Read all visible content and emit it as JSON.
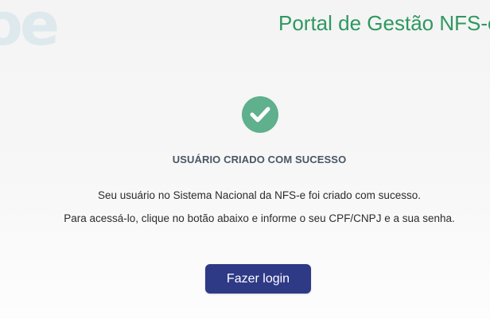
{
  "header": {
    "watermark": "oe",
    "title": "Portal de Gestão NFS-e"
  },
  "status": {
    "icon": "check-circle-icon",
    "heading": "USUÁRIO CRIADO COM SUCESSO"
  },
  "messages": {
    "line1": "Seu usuário no Sistema Nacional da NFS-e foi criado com sucesso.",
    "line2": "Para acessá-lo, clique no botão abaixo e informe o seu CPF/CNPJ e a sua senha."
  },
  "actions": {
    "login_label": "Fazer login"
  },
  "colors": {
    "title_green": "#2e9860",
    "check_green": "#5fb08c",
    "button_navy": "#2f3a86",
    "heading_gray": "#4a5666"
  }
}
